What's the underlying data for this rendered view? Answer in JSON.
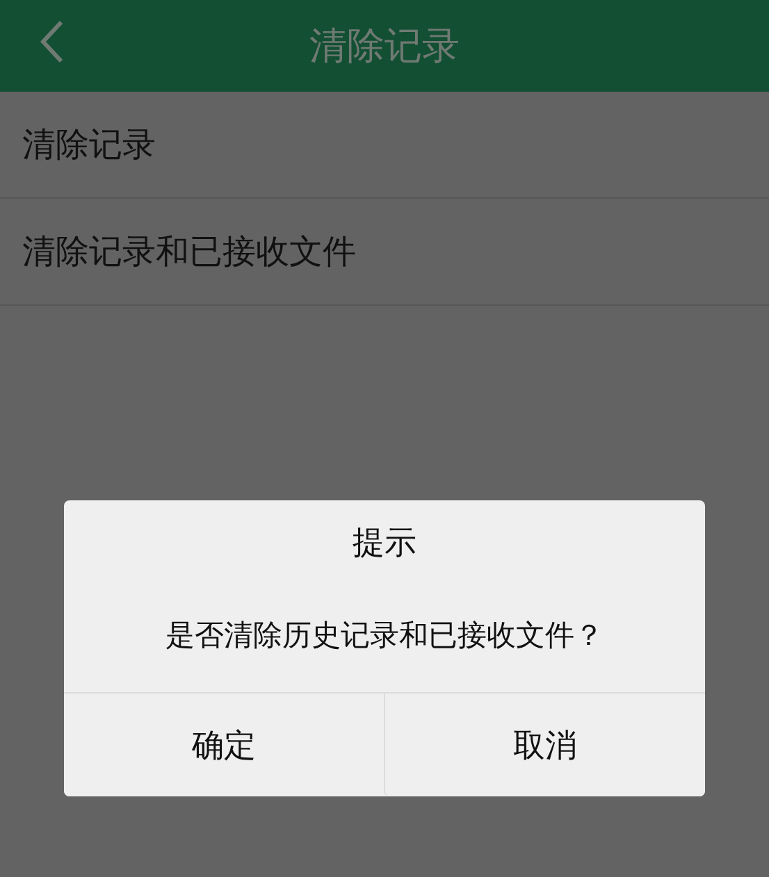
{
  "header": {
    "title": "清除记录"
  },
  "items": [
    {
      "label": "清除记录"
    },
    {
      "label": "清除记录和已接收文件"
    }
  ],
  "dialog": {
    "title": "提示",
    "message": "是否清除历史记录和已接收文件？",
    "buttons": [
      {
        "label": "确定"
      },
      {
        "label": "取消"
      }
    ]
  }
}
